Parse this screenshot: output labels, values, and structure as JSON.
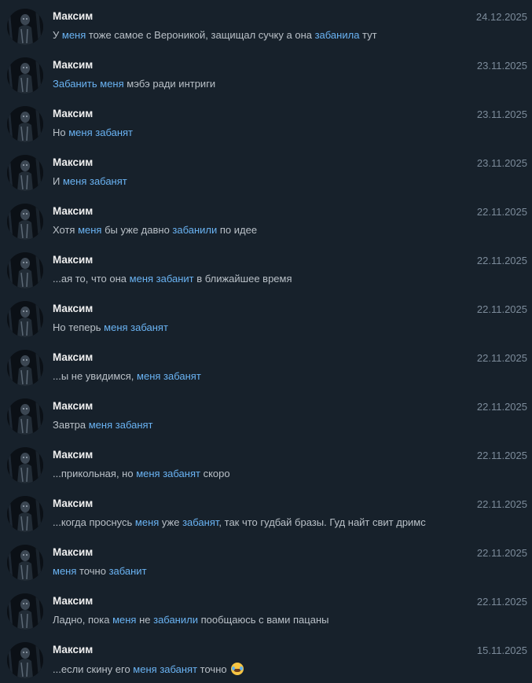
{
  "results": [
    {
      "author": "Максим",
      "date": "24.12.2025",
      "parts": [
        [
          "У ",
          0
        ],
        [
          "меня",
          1
        ],
        [
          " тоже самое с Вероникой, защищал сучку а она ",
          0
        ],
        [
          "забанила",
          1
        ],
        [
          " тут",
          0
        ]
      ]
    },
    {
      "author": "Максим",
      "date": "23.11.2025",
      "parts": [
        [
          "Забанить",
          1
        ],
        [
          " ",
          0
        ],
        [
          "меня",
          1
        ],
        [
          " мэбэ ради интриги",
          0
        ]
      ]
    },
    {
      "author": "Максим",
      "date": "23.11.2025",
      "parts": [
        [
          "Но ",
          0
        ],
        [
          "меня",
          1
        ],
        [
          " ",
          0
        ],
        [
          "забанят",
          1
        ]
      ]
    },
    {
      "author": "Максим",
      "date": "23.11.2025",
      "parts": [
        [
          "И ",
          0
        ],
        [
          "меня",
          1
        ],
        [
          " ",
          0
        ],
        [
          "забанят",
          1
        ]
      ]
    },
    {
      "author": "Максим",
      "date": "22.11.2025",
      "parts": [
        [
          "Хотя ",
          0
        ],
        [
          "меня",
          1
        ],
        [
          " бы уже давно ",
          0
        ],
        [
          "забанили",
          1
        ],
        [
          " по идее",
          0
        ]
      ]
    },
    {
      "author": "Максим",
      "date": "22.11.2025",
      "parts": [
        [
          "...ая то, что она ",
          0
        ],
        [
          "меня",
          1
        ],
        [
          " ",
          0
        ],
        [
          "забанит",
          1
        ],
        [
          " в ближайшее время",
          0
        ]
      ]
    },
    {
      "author": "Максим",
      "date": "22.11.2025",
      "parts": [
        [
          "Но теперь ",
          0
        ],
        [
          "меня",
          1
        ],
        [
          " ",
          0
        ],
        [
          "забанят",
          1
        ]
      ]
    },
    {
      "author": "Максим",
      "date": "22.11.2025",
      "parts": [
        [
          "...ы не увидимся, ",
          0
        ],
        [
          "меня",
          1
        ],
        [
          " ",
          0
        ],
        [
          "забанят",
          1
        ]
      ]
    },
    {
      "author": "Максим",
      "date": "22.11.2025",
      "parts": [
        [
          "Завтра ",
          0
        ],
        [
          "меня",
          1
        ],
        [
          " ",
          0
        ],
        [
          "забанят",
          1
        ]
      ]
    },
    {
      "author": "Максим",
      "date": "22.11.2025",
      "parts": [
        [
          "...прикольная, но ",
          0
        ],
        [
          "меня",
          1
        ],
        [
          " ",
          0
        ],
        [
          "забанят",
          1
        ],
        [
          " скоро",
          0
        ]
      ]
    },
    {
      "author": "Максим",
      "date": "22.11.2025",
      "parts": [
        [
          "...когда проснусь ",
          0
        ],
        [
          "меня",
          1
        ],
        [
          " уже ",
          0
        ],
        [
          "забанят",
          1
        ],
        [
          ", так что гудбай бразы. Гуд найт свит дримс",
          0
        ]
      ]
    },
    {
      "author": "Максим",
      "date": "22.11.2025",
      "parts": [
        [
          "меня",
          1
        ],
        [
          " точно ",
          0
        ],
        [
          "забанит",
          1
        ]
      ]
    },
    {
      "author": "Максим",
      "date": "22.11.2025",
      "parts": [
        [
          "Ладно, пока ",
          0
        ],
        [
          "меня",
          1
        ],
        [
          " не ",
          0
        ],
        [
          "забанили",
          1
        ],
        [
          " пообщаюсь с вами пацаны",
          0
        ]
      ]
    },
    {
      "author": "Максим",
      "date": "15.11.2025",
      "parts": [
        [
          "...если скину его ",
          0
        ],
        [
          "меня",
          1
        ],
        [
          " ",
          0
        ],
        [
          "забанят",
          1
        ],
        [
          " точно",
          0
        ]
      ],
      "emoji": "face-with-tears-of-joy"
    }
  ],
  "colors": {
    "background": "#17212b",
    "author": "#f0f0f0",
    "date": "#7c8b9a",
    "text": "#b9c0c7",
    "highlight": "#6ab3f3"
  },
  "icons": {
    "avatar": "dark-figure-avatar",
    "emoji": "face-with-tears-of-joy-icon"
  }
}
